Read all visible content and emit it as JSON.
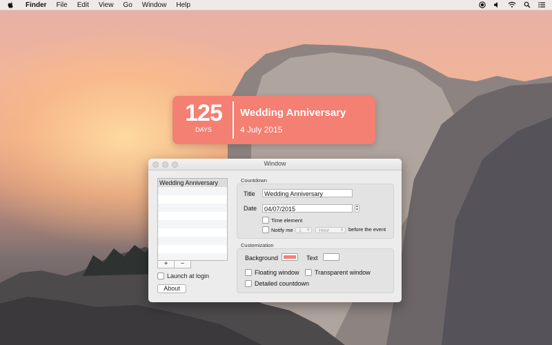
{
  "menubar": {
    "app_name": "Finder",
    "menus": [
      "File",
      "Edit",
      "View",
      "Go",
      "Window",
      "Help"
    ],
    "status_icons": [
      "record-icon",
      "volume-icon",
      "wifi-icon",
      "spotlight-icon",
      "notification-center-icon"
    ]
  },
  "widget": {
    "count": "125",
    "unit": "DAYS",
    "title": "Wedding Anniversary",
    "date": "4 July 2015",
    "color": "#f47f73"
  },
  "window": {
    "title": "Window",
    "list": {
      "items": [
        "Wedding Anniversary"
      ],
      "add_label": "+",
      "remove_label": "−"
    },
    "launch_at_login_label": "Launch at login",
    "launch_at_login_checked": false,
    "about_label": "About",
    "countdown": {
      "section_label": "Countdown",
      "title_label": "Title",
      "title_value": "Wedding Anniversary",
      "date_label": "Date",
      "date_value": "04/07/2015",
      "time_element_label": "Time element",
      "time_element_checked": false,
      "notify_label": "Notify me",
      "notify_checked": false,
      "notify_amount": "1",
      "notify_unit": "Hour",
      "notify_suffix": "before the event"
    },
    "customization": {
      "section_label": "Customization",
      "background_label": "Background",
      "background_color": "#f47f73",
      "text_label": "Text",
      "text_color": "#ffffff",
      "floating_label": "Floating window",
      "floating_checked": false,
      "transparent_label": "Transparent window",
      "transparent_checked": false,
      "detailed_label": "Detailed countdown",
      "detailed_checked": false
    }
  }
}
